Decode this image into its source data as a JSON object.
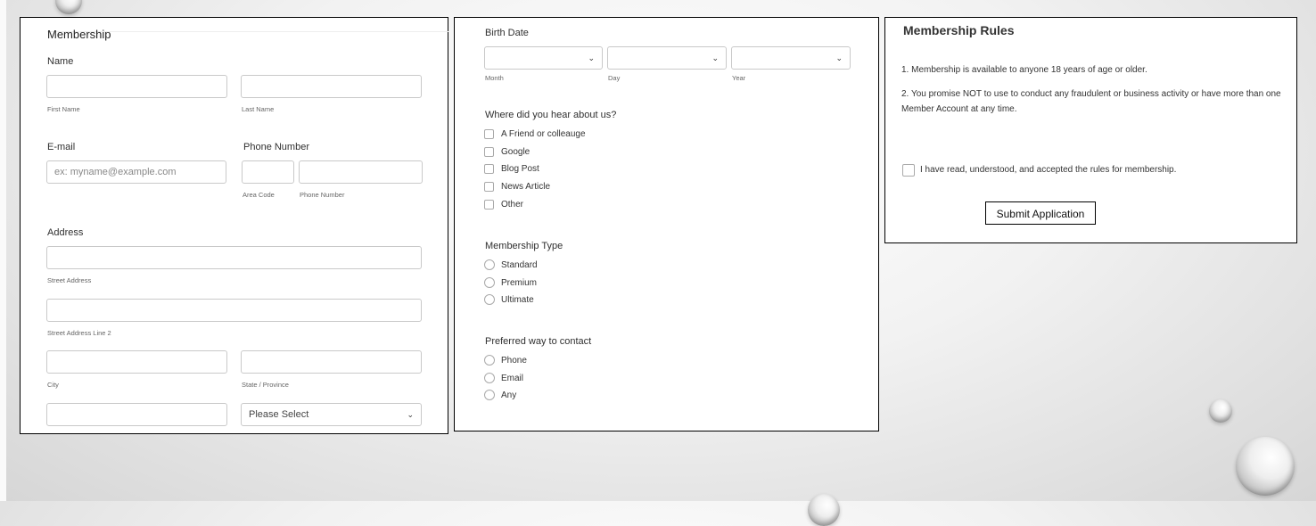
{
  "membership_form": {
    "section_title": "Membership",
    "name": {
      "label": "Name",
      "first_sub": "First Name",
      "last_sub": "Last Name"
    },
    "email": {
      "label": "E-mail",
      "placeholder": "ex: myname@example.com"
    },
    "phone": {
      "label": "Phone Number",
      "area_sub": "Area Code",
      "number_sub": "Phone Number"
    },
    "address": {
      "label": "Address",
      "street_sub": "Street Address",
      "street2_sub": "Street Address Line 2",
      "city_sub": "City",
      "state_sub": "State / Province",
      "country_select": "Please Select"
    }
  },
  "survey": {
    "birth": {
      "label": "Birth Date",
      "month_sub": "Month",
      "day_sub": "Day",
      "year_sub": "Year"
    },
    "hear": {
      "label": "Where did you hear about us?",
      "options": [
        "A Friend or colleauge",
        "Google",
        "Blog Post",
        "News Article",
        "Other"
      ]
    },
    "membership_type": {
      "label": "Membership Type",
      "options": [
        "Standard",
        "Premium",
        "Ultimate"
      ]
    },
    "contact": {
      "label": "Preferred way to contact",
      "options": [
        "Phone",
        "Email",
        "Any"
      ]
    }
  },
  "rules": {
    "title": "Membership Rules",
    "rule1": "1. Membership is available to anyone 18 years of age or older.",
    "rule2": "2. You promise NOT to use to conduct any fraudulent or business activity or have more than one Member Account at any time.",
    "accept": "I have read, understood, and accepted the rules for membership.",
    "submit": "Submit Application"
  },
  "icons": {
    "dropdown": "chevron-down-icon"
  }
}
